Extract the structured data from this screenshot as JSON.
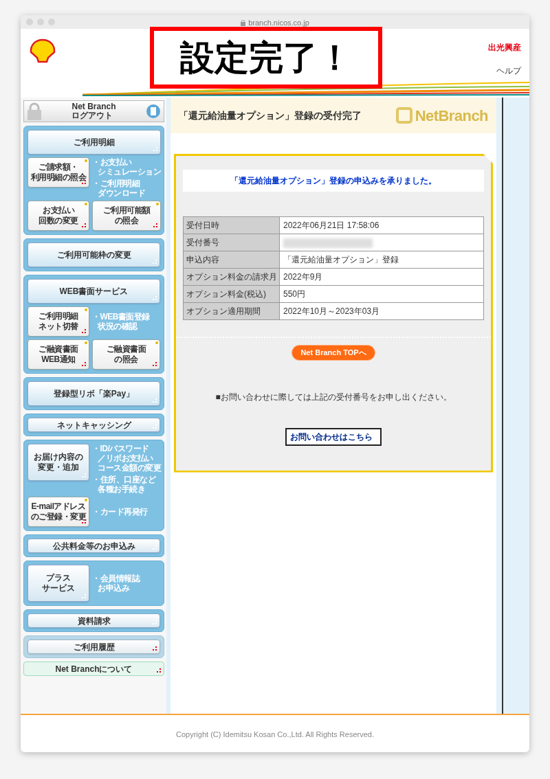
{
  "browser": {
    "url": "branch.nicos.co.jp"
  },
  "callout": "設定完了！",
  "header": {
    "company": "出光興産",
    "help_link": "ヘルプ"
  },
  "sidebar": {
    "logout": [
      "Net Branch",
      "ログアウト"
    ],
    "groups": [
      {
        "kind": "panel",
        "rows": [
          [
            {
              "kind": "main",
              "lines": [
                "ご利用明細"
              ]
            }
          ],
          [
            {
              "kind": "tile",
              "lines": [
                "ご請求額・",
                "利用明細の照会"
              ]
            },
            {
              "kind": "links",
              "items": [
                [
                  "・お支払い",
                  "シミュレーション"
                ],
                [
                  "・ご利用明細",
                  "ダウンロード"
                ]
              ]
            }
          ],
          [
            {
              "kind": "tile",
              "lines": [
                "お支払い",
                "回数の変更"
              ]
            },
            {
              "kind": "tile",
              "lines": [
                "ご利用可能額",
                "の照会"
              ]
            }
          ]
        ]
      },
      {
        "kind": "panel",
        "rows": [
          [
            {
              "kind": "main",
              "lines": [
                "ご利用可能枠の変更"
              ]
            }
          ]
        ]
      },
      {
        "kind": "panel",
        "rows": [
          [
            {
              "kind": "main",
              "lines": [
                "WEB書面サービス"
              ]
            }
          ],
          [
            {
              "kind": "tile",
              "lines": [
                "ご利用明細",
                "ネット切替"
              ]
            },
            {
              "kind": "links",
              "items": [
                [
                  "・WEB書面登録",
                  "状況の確認"
                ]
              ]
            }
          ],
          [
            {
              "kind": "tile",
              "lines": [
                "ご融資書面",
                "WEB通知"
              ]
            },
            {
              "kind": "tile",
              "lines": [
                "ご融資書面",
                "の照会"
              ]
            }
          ]
        ]
      },
      {
        "kind": "panel",
        "rows": [
          [
            {
              "kind": "main",
              "lines": [
                "登録型リボ「楽Pay」"
              ]
            }
          ]
        ]
      },
      {
        "kind": "panel",
        "rows": [
          [
            {
              "kind": "slim",
              "lines": [
                "ネットキャッシング"
              ]
            }
          ]
        ]
      },
      {
        "kind": "panel",
        "rows": [
          [
            {
              "kind": "card",
              "lines": [
                "お届け内容の",
                "変更・追加"
              ]
            },
            {
              "kind": "links",
              "items": [
                [
                  "・ID/パスワード",
                  "／リボお支払い",
                  "コース金額の変更"
                ],
                [
                  "・住所、口座など",
                  "各種お手続き"
                ]
              ]
            }
          ],
          [
            {
              "kind": "tile",
              "lines": [
                "E-mailアドレス",
                "のご登録・変更"
              ]
            },
            {
              "kind": "links",
              "items": [
                [
                  "・カード再発行"
                ]
              ]
            }
          ]
        ]
      },
      {
        "kind": "panel",
        "rows": [
          [
            {
              "kind": "slim",
              "lines": [
                "公共料金等のお申込み"
              ]
            }
          ]
        ]
      },
      {
        "kind": "panel",
        "rows": [
          [
            {
              "kind": "card",
              "lines": [
                "プラス",
                "サービス"
              ]
            },
            {
              "kind": "links",
              "items": [
                [
                  "・会員情報誌",
                  "お申込み"
                ]
              ]
            }
          ]
        ]
      },
      {
        "kind": "panel",
        "rows": [
          [
            {
              "kind": "slim",
              "lines": [
                "資料請求"
              ]
            }
          ]
        ]
      },
      {
        "kind": "muted",
        "rows": [
          [
            {
              "kind": "slim",
              "lines": [
                "ご利用履歴"
              ]
            }
          ]
        ]
      },
      {
        "kind": "bare",
        "rows": [
          [
            {
              "kind": "slim",
              "lines": [
                "Net Branchについて"
              ]
            }
          ]
        ]
      }
    ]
  },
  "content": {
    "title": "「還元給油量オプション」登録の受付完了",
    "logo": "NetBranch",
    "message": "「還元給油量オプション」登録の申込みを承りました。",
    "table": {
      "rows": [
        {
          "label": "受付日時",
          "value": "2022年06月21日 17:58:06"
        },
        {
          "label": "受付番号",
          "redacted": true
        },
        {
          "label": "申込内容",
          "value": "「還元給油量オプション」登録"
        },
        {
          "label": "オプション料金の請求月",
          "value": "2022年9月"
        },
        {
          "label": "オプション料金(税込)",
          "value": "550円"
        },
        {
          "label": "オプション適用期間",
          "value": "2022年10月～2023年03月"
        }
      ]
    },
    "top_button": "Net Branch TOPへ",
    "notice": "■お問い合わせに際しては上記の受付番号をお申し出ください。",
    "contact_button": "お問い合わせはこちら"
  },
  "footer": {
    "copyright": "Copyright (C) Idemitsu Kosan Co.,Ltd. All Rights Reserved."
  }
}
